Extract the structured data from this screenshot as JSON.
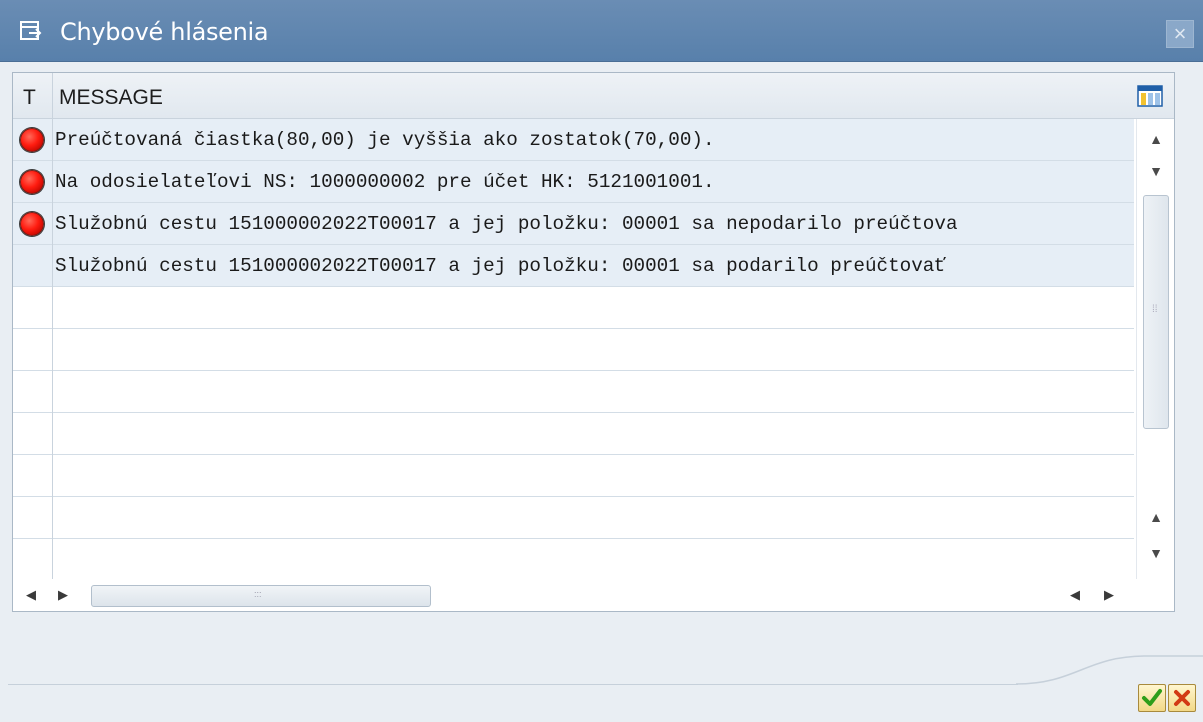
{
  "dialog": {
    "title": "Chybové hlásenia",
    "close_glyph": "×"
  },
  "table": {
    "columns": [
      "T",
      "MESSAGE"
    ],
    "rows": [
      {
        "type": "error",
        "message": "Preúčtovaná čiastka(80,00) je vyššia ako zostatok(70,00)."
      },
      {
        "type": "error",
        "message": "Na odosielateľovi NS: 1000000002 pre účet HK: 5121001001."
      },
      {
        "type": "error",
        "message": "Služobnú cestu 151000002022T00017 a jej položku: 00001 sa nepodarilo preúčtova"
      },
      {
        "type": "none",
        "message": "Služobnú cestu 151000002022T00017 a jej položku: 00001 sa podarilo preúčtovať"
      }
    ],
    "empty_row_count": 7
  },
  "icons": {
    "dialog": "dialog-window-icon",
    "layout": "change-layout-icon",
    "error": "red-light-icon",
    "confirm": "check-icon",
    "cancel": "cross-icon"
  },
  "colors": {
    "titlebar": "#5f85ae",
    "row_highlight": "#e6eef6",
    "error_led": "#ff1c10",
    "confirm_green": "#2f9e1a",
    "cancel_red": "#d23a14"
  }
}
